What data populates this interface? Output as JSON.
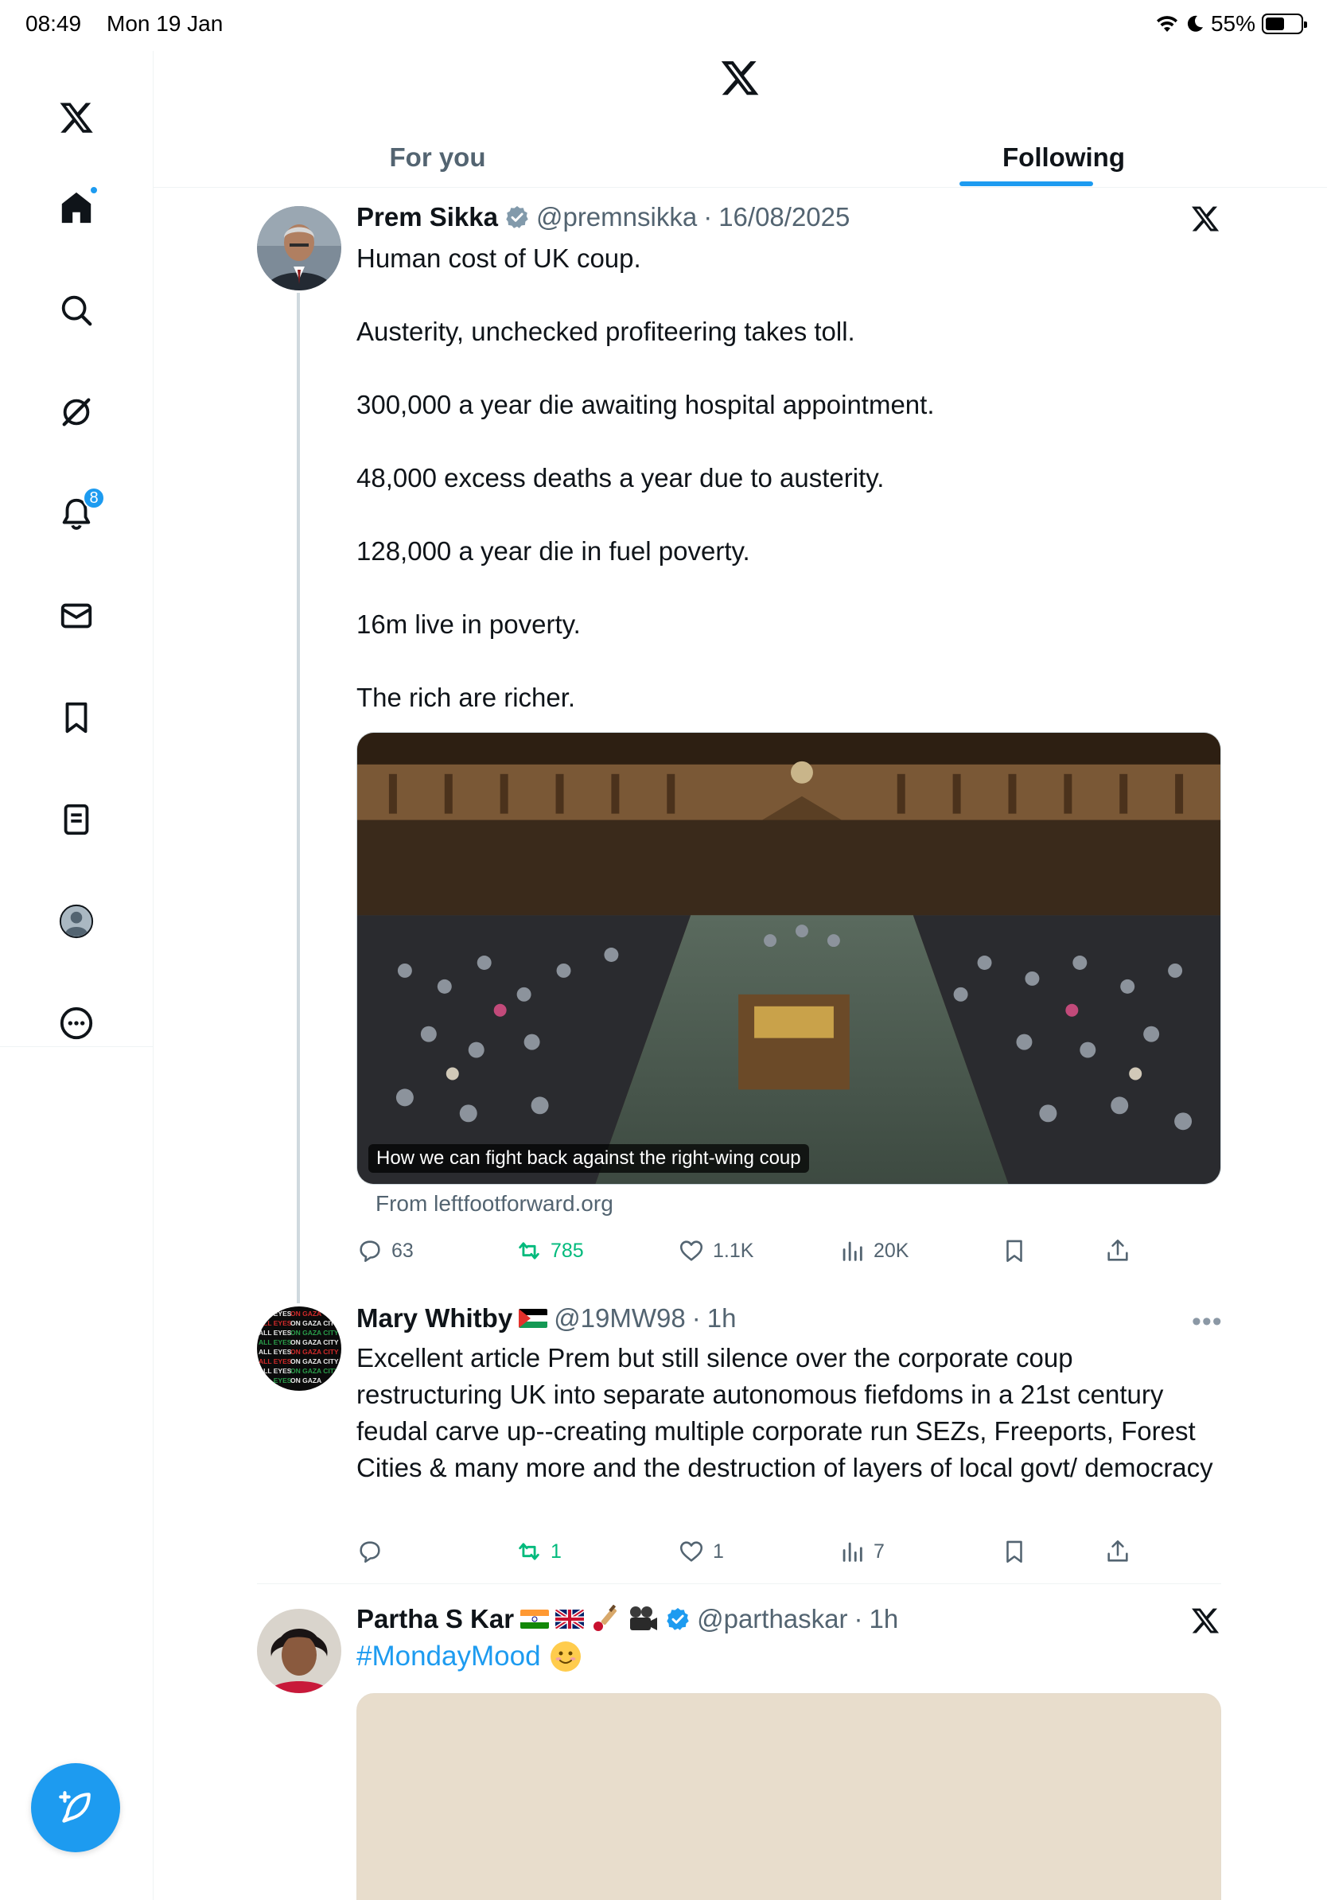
{
  "status_bar": {
    "time": "08:49",
    "date": "Mon 19 Jan",
    "battery": "55%",
    "battery_level": 0.55
  },
  "tabs": {
    "for_you": "For you",
    "following": "Following",
    "active": "Following"
  },
  "sidebar": {
    "notifications_badge": "8"
  },
  "posts": [
    {
      "name": "Prem Sikka",
      "handle": "@premnsikka",
      "separator": "·",
      "time": "16/08/2025",
      "paragraphs": [
        "Human cost of UK coup.",
        "Austerity, unchecked profiteering takes toll.",
        "300,000 a year die awaiting hospital appointment.",
        "48,000 excess deaths a year due to austerity.",
        "128,000 a year die in fuel poverty.",
        "16m live in poverty.",
        "The rich are richer."
      ],
      "card_caption": "How we can fight back against the right-wing coup",
      "card_source": "From leftfootforward.org",
      "replies": "63",
      "reposts": "785",
      "likes": "1.1K",
      "views": "20K"
    },
    {
      "name": "Mary Whitby",
      "handle": "@19MW98",
      "separator": "·",
      "time": "1h",
      "text": "Excellent article Prem but still silence over the corporate coup restructuring UK into separate autonomous fiefdoms in a 21st century feudal carve up--creating multiple corporate run SEZs, Freeports, Forest Cities & many more and the destruction of layers of local govt/ democracy",
      "avatar_text": "ALL EYES ON GAZA CITY",
      "replies": "",
      "reposts": "1",
      "likes": "1",
      "views": "7"
    },
    {
      "name": "Partha S Kar",
      "handle": "@parthaskar",
      "separator": "·",
      "time": "1h",
      "text": "#MondayMood"
    }
  ],
  "colors": {
    "accent": "#1d9bf0",
    "repost_active": "#00ba7c",
    "secondary_text": "#536471"
  }
}
